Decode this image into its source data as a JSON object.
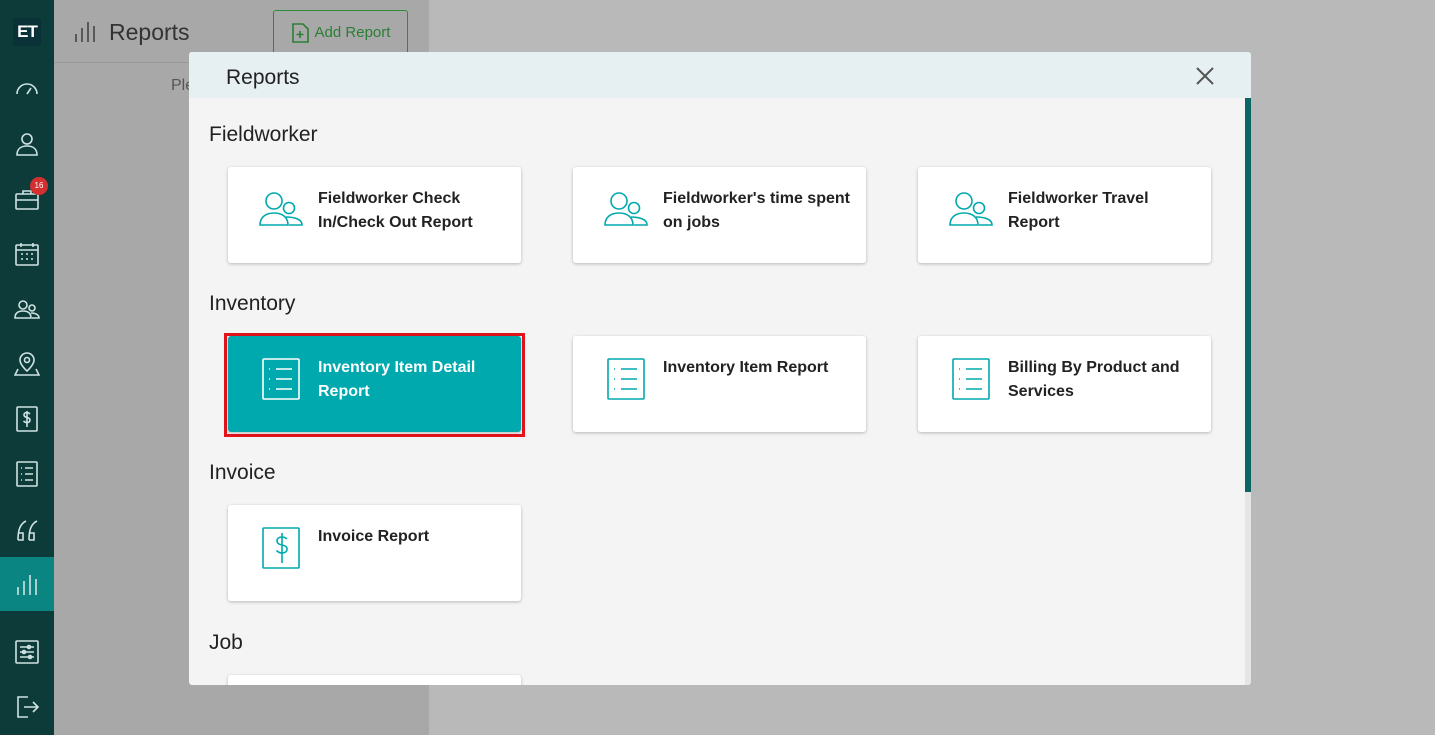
{
  "sidebar": {
    "logo": "ET",
    "badge_count": "16",
    "items": [
      {
        "name": "dashboard"
      },
      {
        "name": "customers"
      },
      {
        "name": "jobs"
      },
      {
        "name": "calendar"
      },
      {
        "name": "fieldworkers"
      },
      {
        "name": "map"
      },
      {
        "name": "invoices"
      },
      {
        "name": "items"
      },
      {
        "name": "quotes"
      },
      {
        "name": "reports"
      },
      {
        "name": "settings"
      },
      {
        "name": "logout"
      }
    ]
  },
  "page": {
    "title": "Reports",
    "add_report_label": "Add Report",
    "hint": "Ple"
  },
  "modal": {
    "title": "Reports",
    "sections": [
      {
        "title": "Fieldworker",
        "cards": [
          {
            "label": "Fieldworker Check In/Check Out Report",
            "icon": "people-icon"
          },
          {
            "label": "Fieldworker's time spent on jobs",
            "icon": "people-icon"
          },
          {
            "label": "Fieldworker Travel Report",
            "icon": "people-icon"
          }
        ]
      },
      {
        "title": "Inventory",
        "cards": [
          {
            "label": "Inventory Item Detail Report",
            "icon": "list-icon",
            "selected": true
          },
          {
            "label": "Inventory Item Report",
            "icon": "list-icon"
          },
          {
            "label": "Billing By Product and Services",
            "icon": "list-icon"
          }
        ]
      },
      {
        "title": "Invoice",
        "cards": [
          {
            "label": "Invoice Report",
            "icon": "dollar-icon"
          }
        ]
      },
      {
        "title": "Job",
        "cards": []
      }
    ]
  },
  "colors": {
    "sidebar": "#0d3b3a",
    "accent": "#00a9ad",
    "highlight": "#e3141b"
  }
}
